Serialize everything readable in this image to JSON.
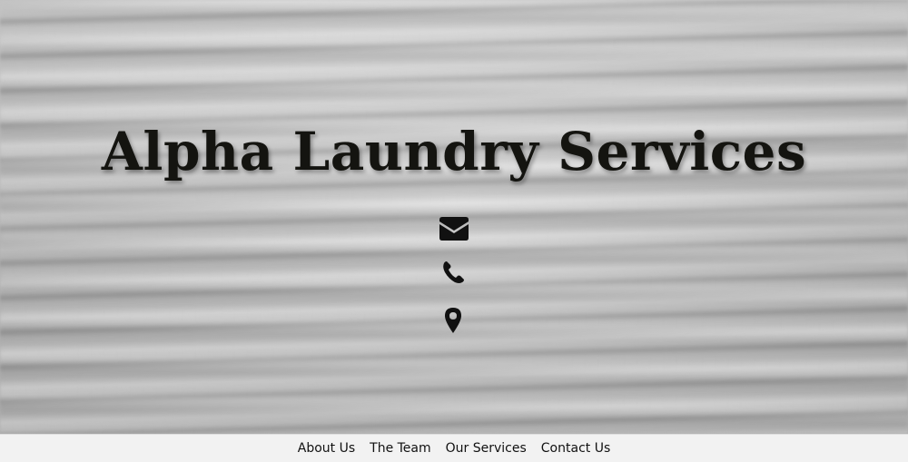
{
  "hero": {
    "title": "Alpha Laundry Services",
    "contact_icons": [
      "envelope-icon",
      "phone-icon",
      "map-marker-icon"
    ]
  },
  "nav": {
    "items": [
      {
        "label": "About Us"
      },
      {
        "label": "The Team"
      },
      {
        "label": "Our Services"
      },
      {
        "label": "Contact Us"
      }
    ]
  },
  "colors": {
    "title": "#141410",
    "icons": "#111111",
    "nav_background": "#f2f2f2"
  }
}
